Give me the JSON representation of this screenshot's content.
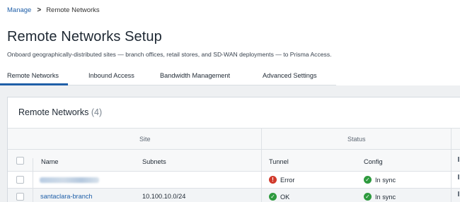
{
  "breadcrumb": {
    "parent": "Manage",
    "separator": ">",
    "current": "Remote Networks"
  },
  "page": {
    "title": "Remote Networks Setup",
    "subtitle": "Onboard geographically-distributed sites — branch offices, retail stores, and SD-WAN deployments — to Prisma Access."
  },
  "tabs": [
    {
      "label": "Remote Networks",
      "active": true
    },
    {
      "label": "Inbound Access",
      "active": false
    },
    {
      "label": "Bandwidth Management",
      "active": false
    },
    {
      "label": "Advanced Settings",
      "active": false
    }
  ],
  "panel": {
    "title": "Remote Networks",
    "count": "(4)"
  },
  "table": {
    "groups": {
      "site": "Site",
      "status": "Status"
    },
    "columns": {
      "name": "Name",
      "subnets": "Subnets",
      "tunnel": "Tunnel",
      "config": "Config"
    },
    "rows": [
      {
        "name": "",
        "name_redacted": true,
        "subnets": "",
        "tunnel": "Error",
        "tunnel_state": "error",
        "config": "In sync",
        "config_state": "ok"
      },
      {
        "name": "santaclara-branch",
        "name_redacted": false,
        "subnets": "10.100.10.0/24",
        "tunnel": "OK",
        "tunnel_state": "ok",
        "config": "In sync",
        "config_state": "ok"
      }
    ]
  },
  "colors": {
    "accent": "#1f5fa8",
    "error": "#d13a2c",
    "ok": "#2e9a3e"
  },
  "icons": {
    "error": "error-icon",
    "ok": "check-circle-icon",
    "separator": "chevron-right-icon"
  }
}
